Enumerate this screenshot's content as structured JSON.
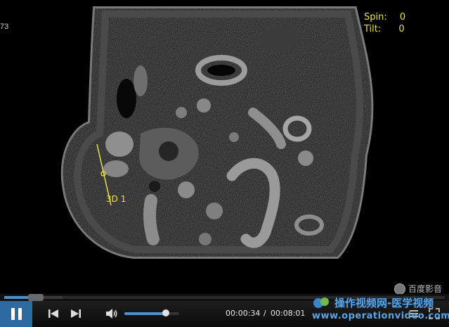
{
  "viewer": {
    "frame_tag": "73",
    "spin_label": "Spin:",
    "spin_value": "0",
    "tilt_label": "Tilt:",
    "tilt_value": "0",
    "measure_label": "3D 1",
    "overlay_color": "#e8e04a"
  },
  "player": {
    "brand_text": "百度影音",
    "current_time": "00:00:34",
    "separator": "/",
    "total_time": "00:08:01",
    "progress_fraction": 0.071,
    "volume_fraction": 0.75,
    "accent_color": "#4f90c8"
  },
  "watermark": {
    "line1": "操作视频网-医学视频",
    "line2": "www.operationvideo.com"
  }
}
